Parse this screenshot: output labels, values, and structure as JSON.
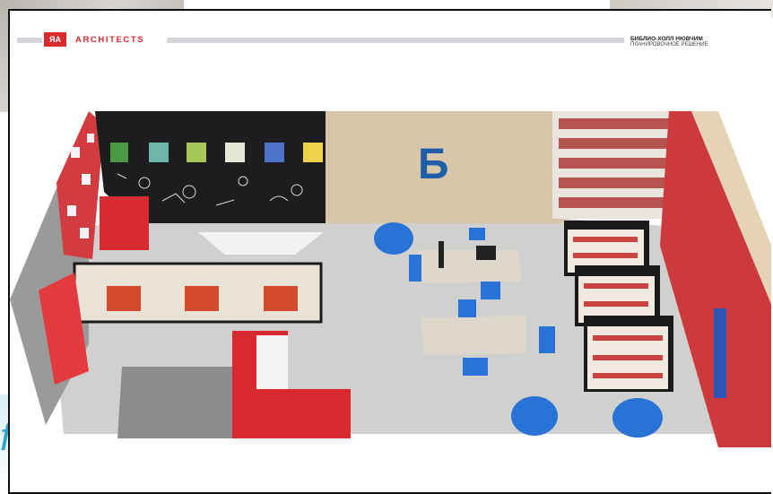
{
  "brand": {
    "logo_text": "ЯА",
    "name": "ARCHITECTS",
    "accent_color": "#d9292d"
  },
  "project": {
    "title": "БИБЛИО-ХОЛЛ НЮВЧИМ",
    "subtitle": "ПЛАНИРОВОЧНОЕ РЕШЕНИЕ"
  },
  "render": {
    "wall_logo": "Б",
    "shelf_color": "#d9292d",
    "furniture_color": "#2a73d6",
    "wall_colors": {
      "black": "#1d1d1f",
      "beige": "#d8c6a8",
      "floor": "#cfcfcd"
    }
  }
}
